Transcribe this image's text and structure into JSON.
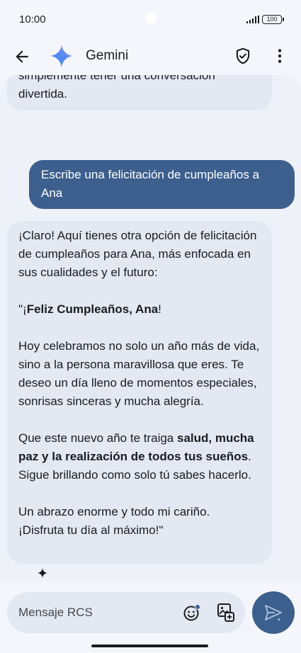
{
  "status_bar": {
    "time": "10:00",
    "battery": "100"
  },
  "app_bar": {
    "title": "Gemini",
    "icons": [
      "back-arrow-icon",
      "gemini-sparkle-logo",
      "shield-check-icon",
      "more-vert-icon"
    ]
  },
  "messages": [
    {
      "role": "assistant",
      "lines": [
        "simplemente tener una conversación",
        "divertida."
      ]
    },
    {
      "role": "user",
      "text": "Escribe una felicitación de cumpleaños a Ana"
    },
    {
      "role": "assistant",
      "p1": "¡Claro! Aquí tienes otra opción de felicitación de cumpleaños para Ana, más enfocada en sus cualidades y el futuro:",
      "p2_open": "\"¡",
      "p2_bold": "Feliz Cumpleaños, Ana",
      "p2_close": "!",
      "p3": "Hoy celebramos no solo un año más de vida, sino a la persona maravillosa que eres. Te deseo un día lleno de momentos especiales, sonrisas sinceras y mucha alegría.",
      "p4_start": "Que este nuevo año te traiga ",
      "p4_bold": "salud, mucha paz y la realización de todos tus sueños",
      "p4_end": ". Sigue brillando como solo tú sabes hacerlo.",
      "p5_line1": "Un abrazo enorme y todo mi cariño.",
      "p5_line2": "¡Disfruta tu día al máximo!\""
    }
  ],
  "composer": {
    "placeholder": "Mensaje RCS",
    "value": "",
    "icons": [
      "emoji-icon",
      "gallery-icon",
      "send-icon"
    ]
  },
  "colors": {
    "accent": "#3c5f8d",
    "bubble_incoming": "#e3e8f3",
    "chat_background": "#eef1f8",
    "app_background": "#f4f6fb"
  }
}
